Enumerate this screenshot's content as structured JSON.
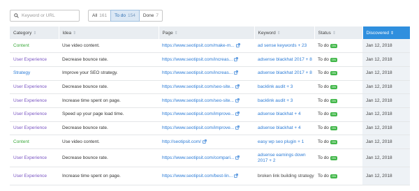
{
  "search": {
    "placeholder": "Keyword or URL"
  },
  "filters": [
    {
      "label": "All",
      "count": "161",
      "active": false
    },
    {
      "label": "To do",
      "count": "154",
      "active": true
    },
    {
      "label": "Done",
      "count": "7",
      "active": false
    }
  ],
  "columns": [
    "Category",
    "Idea",
    "Page",
    "Keyword",
    "Status",
    "Discovered"
  ],
  "status_badge": "ON",
  "colors": {
    "content": "#3aa83a",
    "user_experience": "#7a55c2",
    "strategy": "#2b7bd6",
    "link": "#2b7bd6",
    "sorted_header": "#2f8fde",
    "status_badge": "#41b749"
  },
  "rows": [
    {
      "category": "Content",
      "category_type": "content",
      "idea": "Use video content.",
      "page": "https://www.seotipsit.com/make-m...",
      "keyword": "ad sense keywords + 23",
      "keyword_link": true,
      "status": "To do",
      "discovered": "Jan 12, 2018"
    },
    {
      "category": "User Experience",
      "category_type": "ux",
      "idea": "Decrease bounce rate.",
      "page": "https://www.seotipsit.com/increas...",
      "keyword": "adsense blackhat 2017 + 8",
      "keyword_link": true,
      "status": "To do",
      "discovered": "Jan 12, 2018"
    },
    {
      "category": "Strategy",
      "category_type": "strategy",
      "idea": "Improve your SEO strategy.",
      "page": "https://www.seotipsit.com/increas...",
      "keyword": "adsense blackhat 2017 + 8",
      "keyword_link": true,
      "status": "To do",
      "discovered": "Jan 12, 2018"
    },
    {
      "category": "User Experience",
      "category_type": "ux",
      "idea": "Decrease bounce rate.",
      "page": "https://www.seotipsit.com/seo-site...",
      "keyword": "backlink audit + 3",
      "keyword_link": true,
      "status": "To do",
      "discovered": "Jan 12, 2018"
    },
    {
      "category": "User Experience",
      "category_type": "ux",
      "idea": "Increase time spent on page.",
      "page": "https://www.seotipsit.com/seo-site...",
      "keyword": "backlink audit + 3",
      "keyword_link": true,
      "status": "To do",
      "discovered": "Jan 12, 2018"
    },
    {
      "category": "User Experience",
      "category_type": "ux",
      "idea": "Speed up your page load time.",
      "page": "https://www.seotipsit.com/improve...",
      "keyword": "adsense blackhat + 4",
      "keyword_link": true,
      "status": "To do",
      "discovered": "Jan 12, 2018"
    },
    {
      "category": "User Experience",
      "category_type": "ux",
      "idea": "Decrease bounce rate.",
      "page": "https://www.seotipsit.com/improve...",
      "keyword": "adsense blackhat + 4",
      "keyword_link": true,
      "status": "To do",
      "discovered": "Jan 12, 2018"
    },
    {
      "category": "Content",
      "category_type": "content",
      "idea": "Use video content.",
      "page": "http://seotipsit.com/",
      "keyword": "easy wp seo plugin + 1",
      "keyword_link": true,
      "status": "To do",
      "discovered": "Jan 12, 2018"
    },
    {
      "category": "User Experience",
      "category_type": "ux",
      "idea": "Decrease bounce rate.",
      "page": "https://www.seotipsit.com/compari...",
      "keyword": "adsense earnings down 2017 + 2",
      "keyword_link": true,
      "status": "To do",
      "discovered": "Jan 12, 2018"
    },
    {
      "category": "User Experience",
      "category_type": "ux",
      "idea": "Increase time spent on page.",
      "page": "https://www.seotipsit.com/best-lin...",
      "keyword": "broken link building strategy",
      "keyword_link": false,
      "status": "To do",
      "discovered": "Jan 12, 2018"
    }
  ]
}
